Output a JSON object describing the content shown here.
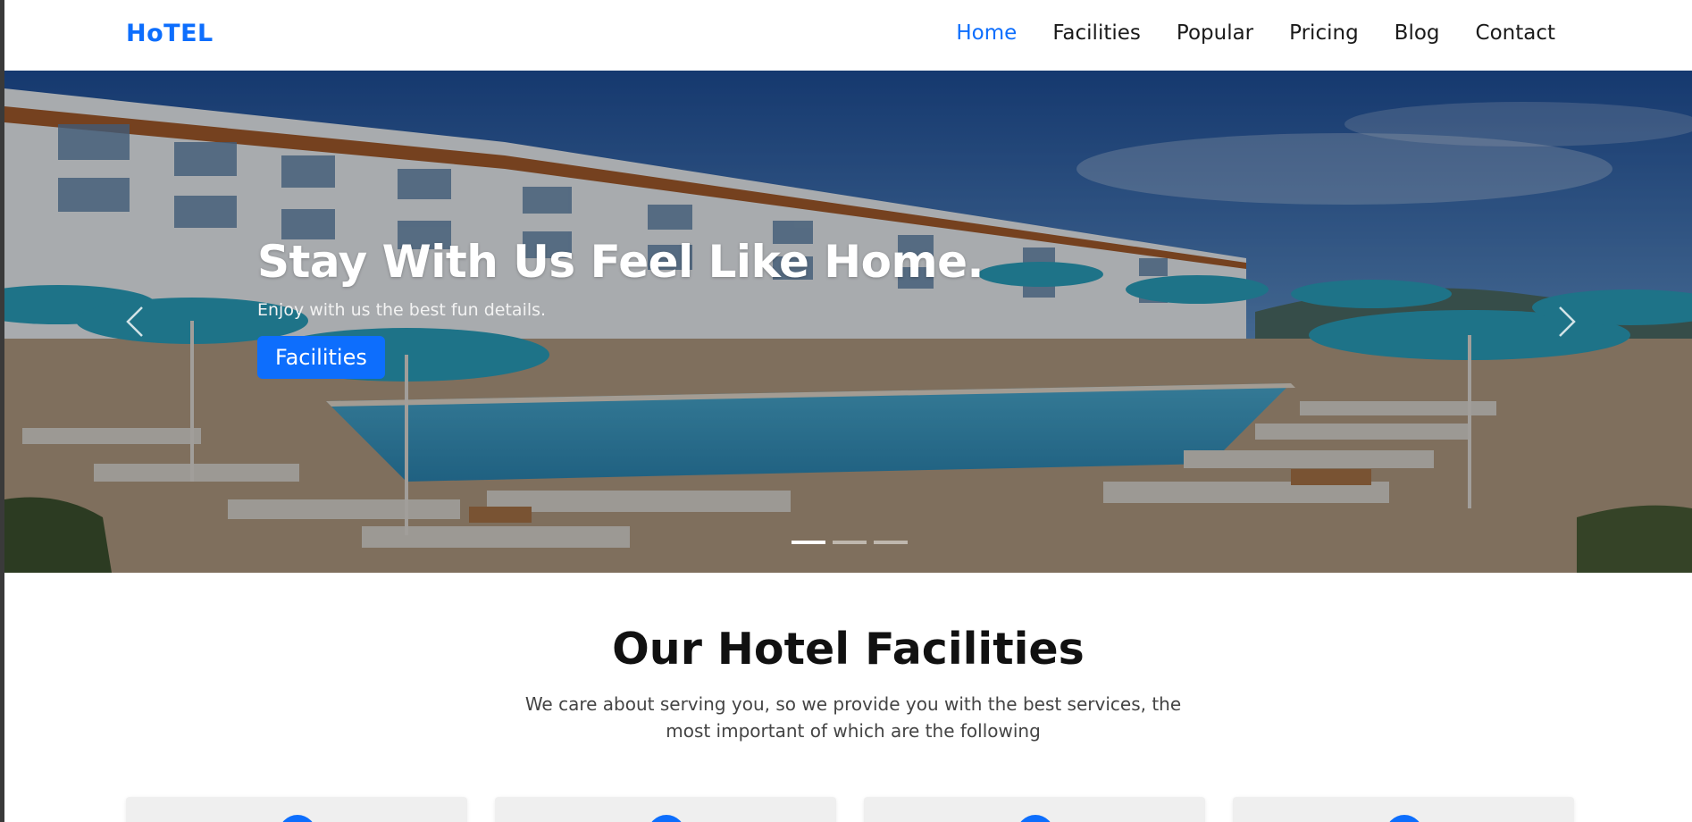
{
  "brand": "HoTEL",
  "nav": [
    {
      "label": "Home",
      "active": true
    },
    {
      "label": "Facilities",
      "active": false
    },
    {
      "label": "Popular",
      "active": false
    },
    {
      "label": "Pricing",
      "active": false
    },
    {
      "label": "Blog",
      "active": false
    },
    {
      "label": "Contact",
      "active": false
    }
  ],
  "hero": {
    "title": "Stay With Us Feel Like Home.",
    "subtitle": "Enjoy with us the best fun details.",
    "button_label": "Facilities",
    "slides": 3,
    "active_slide": 1
  },
  "facilities": {
    "title": "Our Hotel Facilities",
    "description": "We care about serving you, so we provide you with the best services, the most important of which are the following",
    "card_count": 4
  },
  "colors": {
    "accent": "#0d6efd",
    "text": "#1a1a1a",
    "card_bg": "#efefef"
  },
  "icons": {
    "prev": "chevron-left-icon",
    "next": "chevron-right-icon"
  }
}
